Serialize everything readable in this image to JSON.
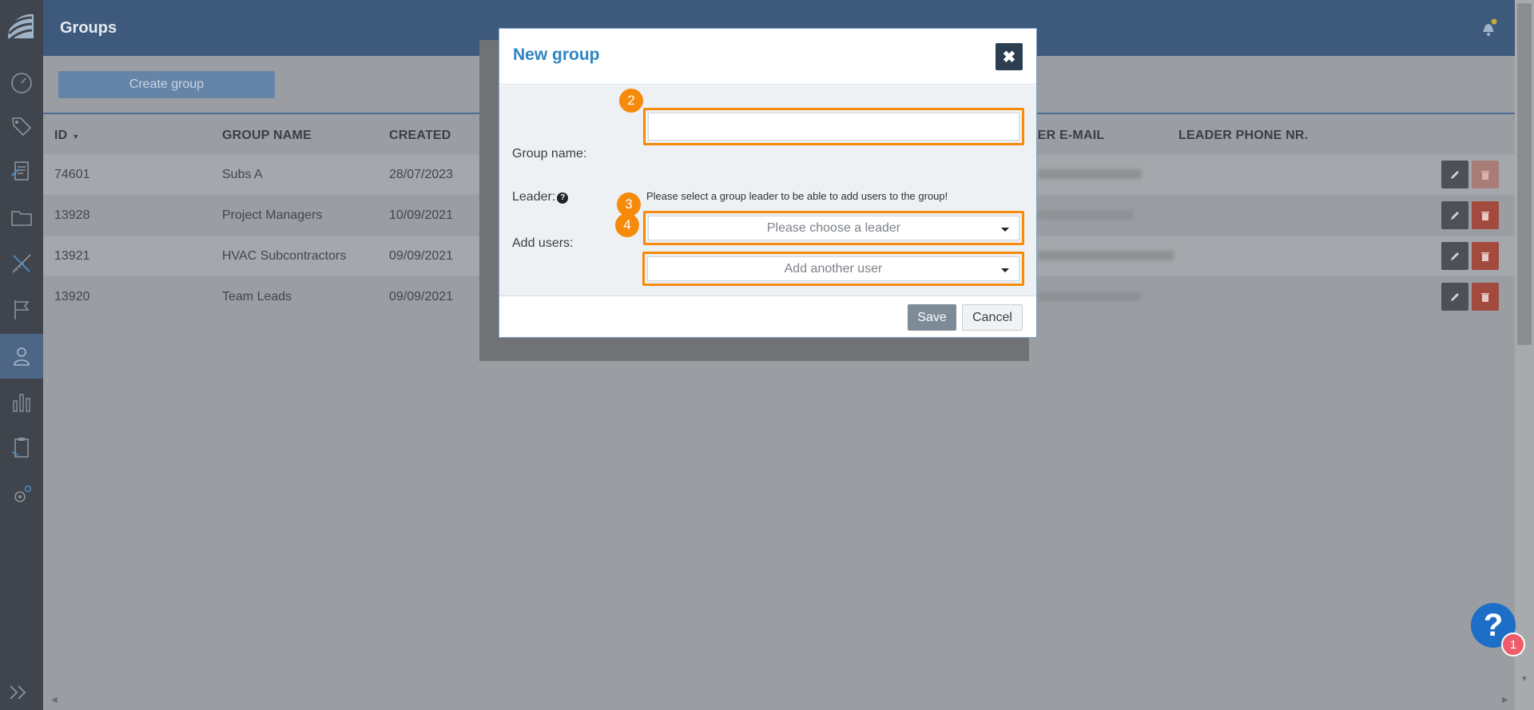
{
  "header": {
    "title": "Groups"
  },
  "toolbar": {
    "create_label": "Create group"
  },
  "table": {
    "columns": {
      "id": "ID",
      "group_name": "GROUP NAME",
      "created": "CREATED",
      "leader_email": "DER E-MAIL",
      "leader_phone": "LEADER PHONE NR."
    },
    "rows": [
      {
        "id": "74601",
        "name": "Subs A",
        "created": "28/07/2023"
      },
      {
        "id": "13928",
        "name": "Project Managers",
        "created": "10/09/2021"
      },
      {
        "id": "13921",
        "name": "HVAC Subcontractors",
        "created": "09/09/2021"
      },
      {
        "id": "13920",
        "name": "Team Leads",
        "created": "09/09/2021"
      }
    ]
  },
  "modal": {
    "title": "New group",
    "close_label": "✖",
    "group_name_label": "Group name:",
    "group_name_value": "",
    "leader_label": "Leader:",
    "leader_help": "?",
    "leader_hint": "Please select a group leader to be able to add users to the group!",
    "leader_placeholder": "Please choose a leader",
    "add_users_label": "Add users:",
    "add_users_placeholder": "Add another user",
    "steps": [
      "2",
      "3",
      "4"
    ],
    "save_label": "Save",
    "cancel_label": "Cancel"
  },
  "help": {
    "icon": "?",
    "badge_count": "1"
  },
  "colors": {
    "accent": "#2f84c3",
    "highlight": "#f58a0b",
    "header": "#3d5a7d",
    "sidebar": "#40444c",
    "delete": "#a24a3d"
  }
}
